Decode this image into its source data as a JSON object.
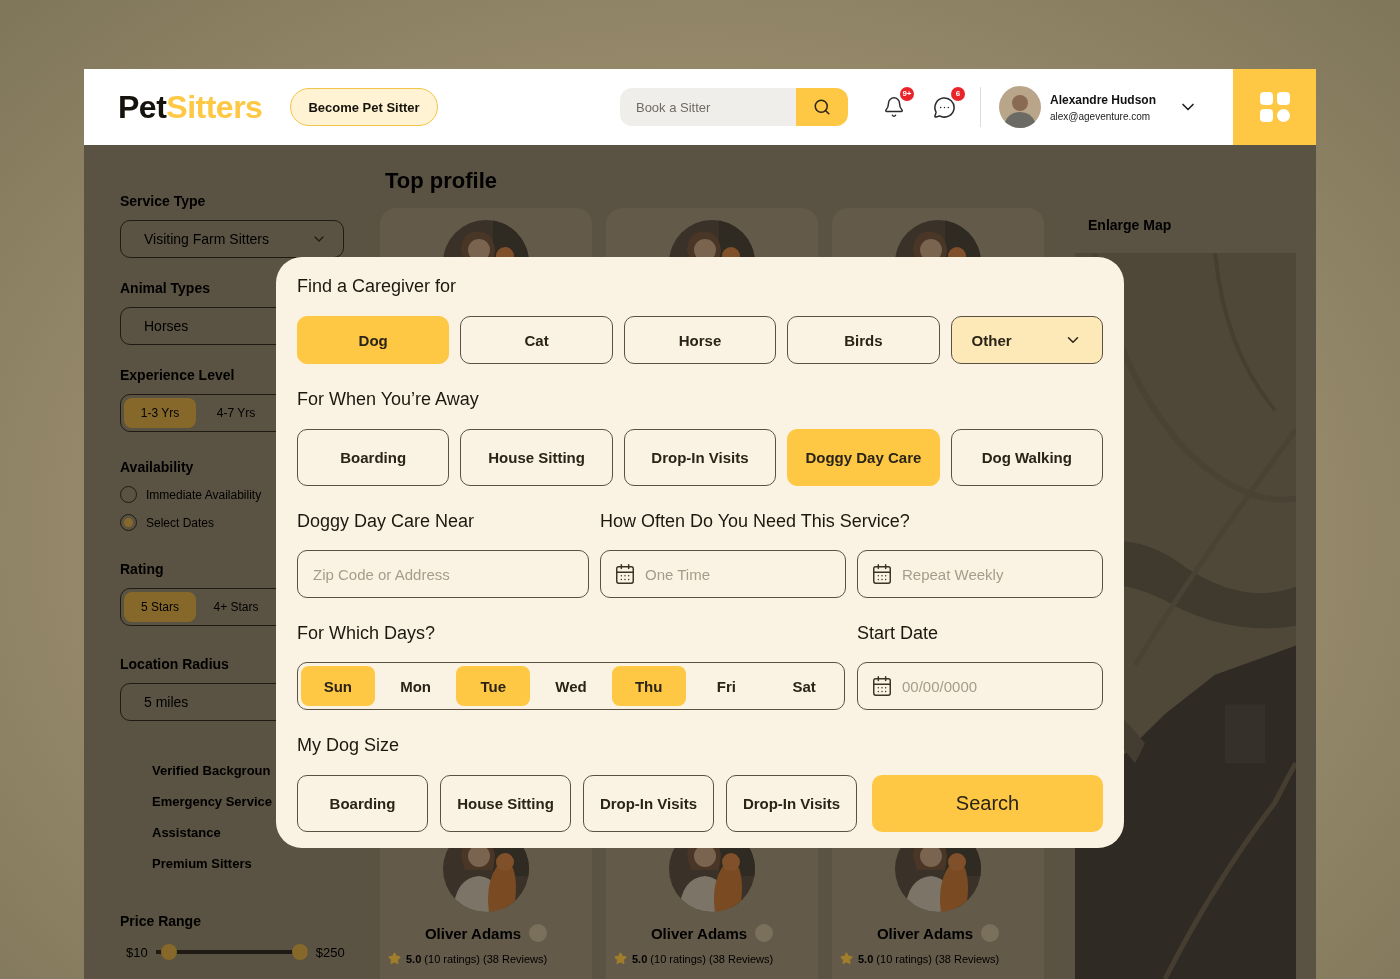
{
  "header": {
    "logo": {
      "prefix": "Pet",
      "suffix": "Sitters"
    },
    "become_button": "Become Pet Sitter",
    "search": {
      "placeholder": "Book a Sitter"
    },
    "notifications": {
      "badge": "9+"
    },
    "messages": {
      "badge": "6"
    },
    "user": {
      "name": "Alexandre Hudson",
      "email": "alex@ageventure.com"
    }
  },
  "sidebar": {
    "sections": [
      {
        "kind": "select",
        "label": "Service Type",
        "value": "Visiting Farm Sitters"
      },
      {
        "kind": "field",
        "label": "Animal Types",
        "value": "Horses"
      },
      {
        "kind": "segmented",
        "label": "Experience Level",
        "options": [
          {
            "label": "1-3 Yrs",
            "selected": true
          },
          {
            "label": "4-7 Yrs",
            "selected": false
          }
        ]
      },
      {
        "kind": "radio",
        "label": "Availability",
        "options": [
          {
            "label": "Immediate Availability",
            "selected": false
          },
          {
            "label": "Select Dates",
            "selected": true
          }
        ]
      },
      {
        "kind": "segmented",
        "label": "Rating",
        "options": [
          {
            "label": "5 Stars",
            "selected": true
          },
          {
            "label": "4+ Stars",
            "selected": false
          }
        ]
      },
      {
        "kind": "field",
        "label": "Location Radius",
        "value": "5 miles"
      },
      {
        "kind": "list",
        "items": [
          "Verified Backgroun",
          "Emergency Service",
          "Assistance",
          "Premium Sitters"
        ]
      },
      {
        "kind": "range",
        "label": "Price Range",
        "min": "$10",
        "max": "$250",
        "thumbs": [
          {
            "level": 0.04
          },
          {
            "level": 1
          }
        ]
      }
    ]
  },
  "profiles": {
    "title": "Top profile",
    "cards": [
      {
        "kind": "picture"
      },
      {
        "kind": "picture"
      },
      {
        "kind": "picture"
      },
      {
        "kind": "profile",
        "name": "Oliver Adams",
        "rating": "**5.0** (10 ratings) (38 Reviews)"
      },
      {
        "kind": "profile",
        "name": "Oliver Adams",
        "rating": "**5.0** (10 ratings) (38 Reviews)"
      },
      {
        "kind": "profile",
        "name": "Oliver Adams",
        "rating": "**5.0** (10 ratings) (38 Reviews)"
      }
    ]
  },
  "map": {
    "label": "Enlarge Map",
    "kind": "picture"
  },
  "dialog": {
    "pet_heading": "Find a Caregiver for",
    "pets": [
      {
        "label": "Dog",
        "kind": "option",
        "selected": true
      },
      {
        "label": "Cat",
        "kind": "option",
        "selected": false
      },
      {
        "label": "Horse",
        "kind": "option",
        "selected": false
      },
      {
        "label": "Birds",
        "kind": "option",
        "selected": false
      },
      {
        "label": "Other",
        "kind": "dropdown",
        "selected": false
      }
    ],
    "service_heading": "For When You’re Away",
    "services": [
      {
        "label": "Boarding",
        "selected": false
      },
      {
        "label": "House Sitting",
        "selected": false
      },
      {
        "label": "Drop-In Visits",
        "selected": false
      },
      {
        "label": "Doggy Day Care",
        "selected": true
      },
      {
        "label": "Dog Walking",
        "selected": false
      }
    ],
    "location_heading": "Doggy Day Care Near",
    "location_field": {
      "placeholder": "Zip Code or Address"
    },
    "frequency_heading": "How Often Do You Need This Service?",
    "frequency_fields": [
      {
        "placeholder": "One Time"
      },
      {
        "placeholder": "Repeat Weekly"
      }
    ],
    "days_heading": "For Which Days?",
    "days": [
      {
        "label": "Sun",
        "selected": true
      },
      {
        "label": "Mon",
        "selected": false
      },
      {
        "label": "Tue",
        "selected": true
      },
      {
        "label": "Wed",
        "selected": false
      },
      {
        "label": "Thu",
        "selected": true
      },
      {
        "label": "Fri",
        "selected": false
      },
      {
        "label": "Sat",
        "selected": false
      }
    ],
    "start_heading": "Start Date",
    "start_field": {
      "placeholder": "00/00/0000"
    },
    "size_heading": "My Dog Size",
    "sizes": [
      {
        "label": "Boarding",
        "selected": false
      },
      {
        "label": "House Sitting",
        "selected": false
      },
      {
        "label": "Drop-In Visits",
        "selected": false
      },
      {
        "label": "Drop-In Visits",
        "selected": false
      }
    ],
    "search_button": "Search"
  }
}
